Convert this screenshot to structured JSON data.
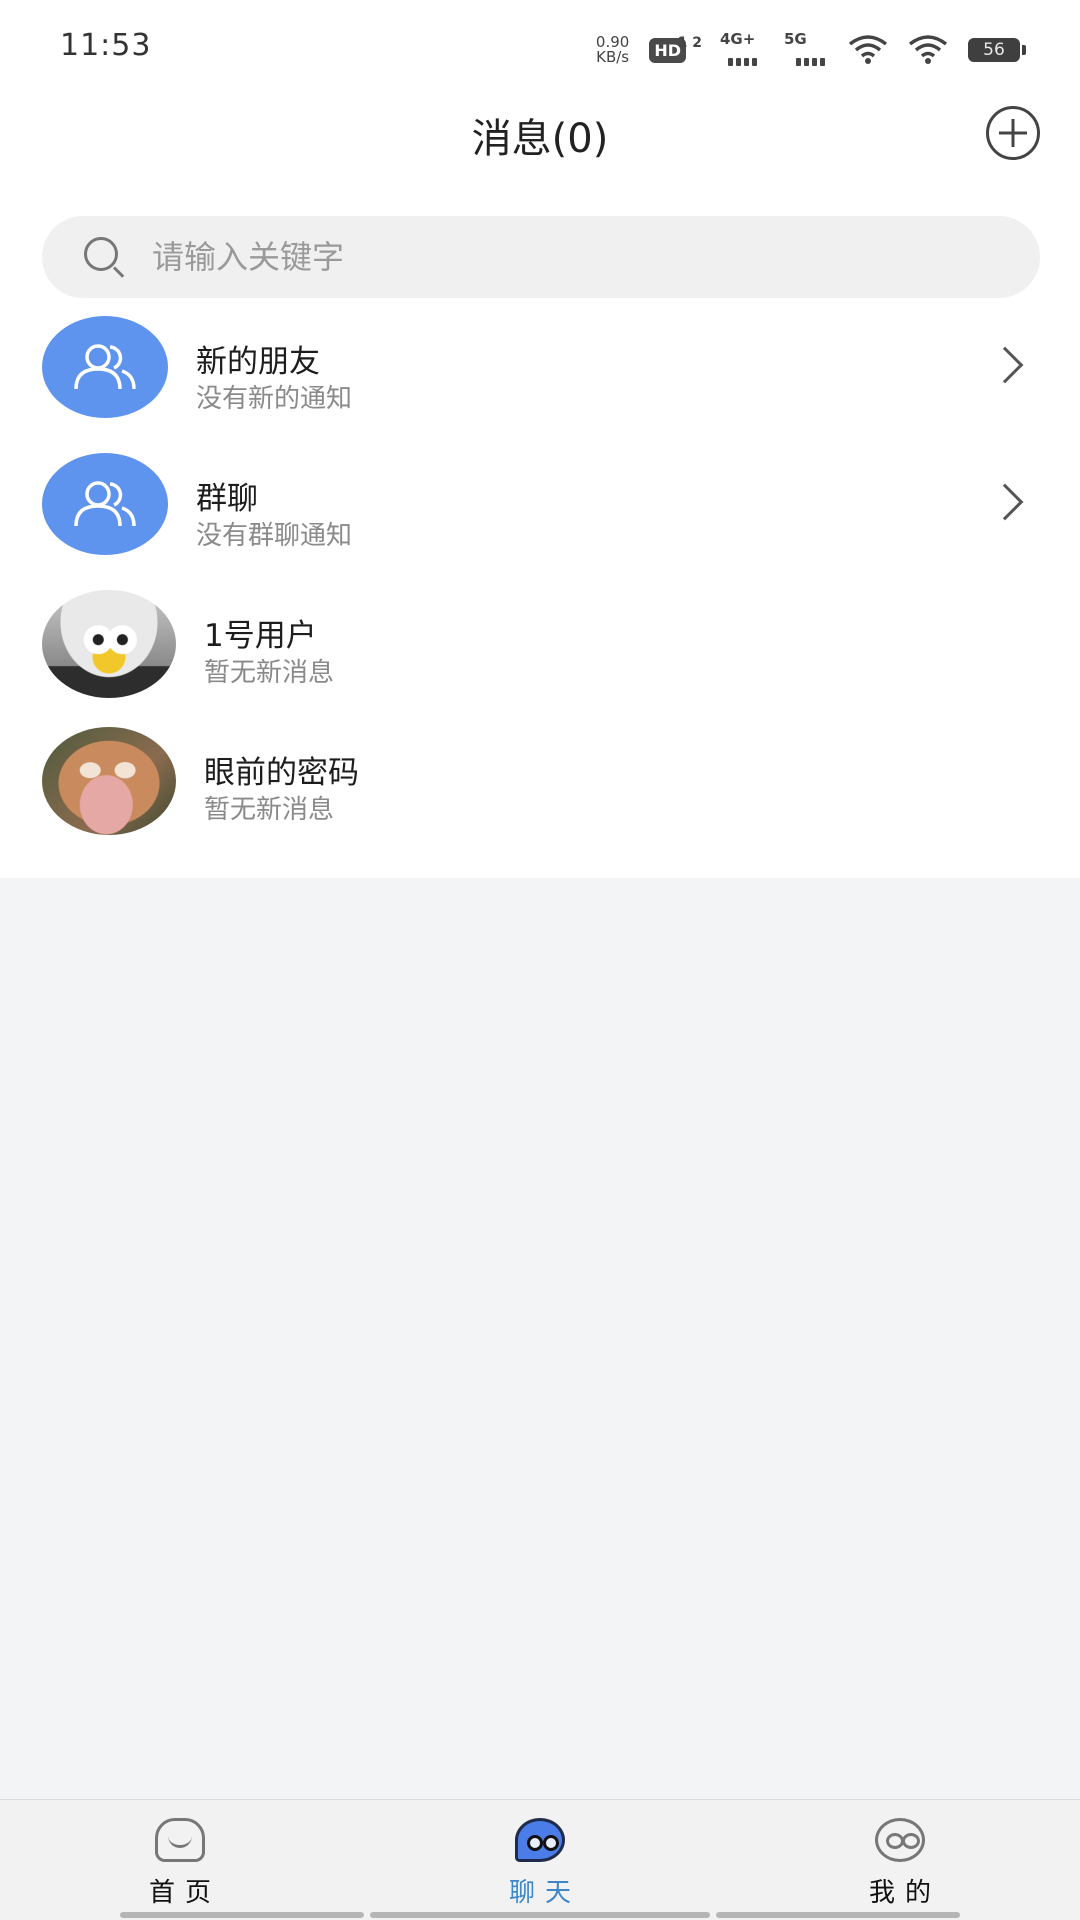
{
  "status_bar": {
    "time": "11:53",
    "net_speed_value": "0.90",
    "net_speed_unit": "KB/s",
    "hd_label": "HD",
    "hd_sim": "1 2",
    "signal_4g": "4G+",
    "signal_5g": "5G",
    "battery": "56"
  },
  "header": {
    "title": "消息(0)",
    "add_icon": "plus-circle-icon"
  },
  "search": {
    "placeholder": "请输入关键字",
    "value": ""
  },
  "list": [
    {
      "title": "新的朋友",
      "subtitle": "没有新的通知",
      "avatar": "group-icon"
    },
    {
      "title": "群聊",
      "subtitle": "没有群聊通知",
      "avatar": "group-icon"
    },
    {
      "title": "1号用户",
      "subtitle": "暂无新消息",
      "avatar": "user-photo"
    },
    {
      "title": "眼前的密码",
      "subtitle": "暂无新消息",
      "avatar": "user-photo"
    }
  ],
  "bottom_nav": {
    "tabs": [
      {
        "label": "首页",
        "icon": "home-icon"
      },
      {
        "label": "聊天",
        "icon": "chat-icon",
        "active": true
      },
      {
        "label": "我的",
        "icon": "profile-icon"
      }
    ]
  },
  "colors": {
    "accent": "#3c86c9",
    "group_avatar": "#5e93ee",
    "page_background": "#f3f4f6"
  }
}
